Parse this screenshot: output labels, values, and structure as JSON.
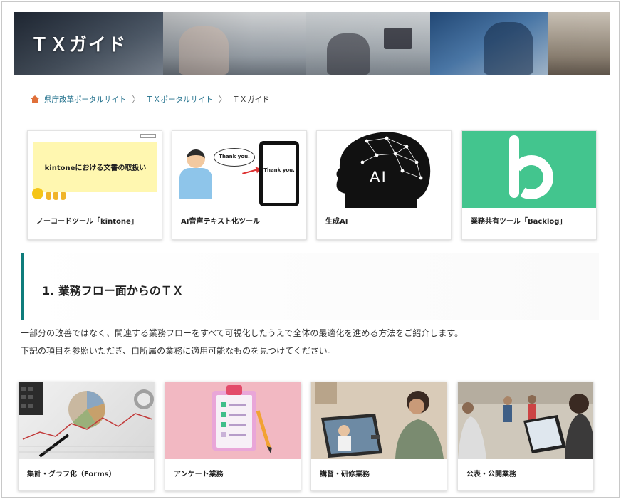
{
  "hero": {
    "title": "ＴＸガイド"
  },
  "breadcrumb": {
    "items": [
      {
        "label": "県庁改革ポータルサイト",
        "link": true
      },
      {
        "label": "ＴＸポータルサイト",
        "link": true
      },
      {
        "label": "ＴＸガイド",
        "link": false
      }
    ],
    "separator": "〉"
  },
  "top_cards": [
    {
      "label": "ノーコードツール「kintone」",
      "thumb_text": "kintoneにおける文書の取扱い"
    },
    {
      "label": "AI音声テキスト化ツール",
      "bubble_text": "Thank you.",
      "phone_text": "Thank you."
    },
    {
      "label": "生成AI",
      "thumb_text": "AI"
    },
    {
      "label": "業務共有ツール「Backlog」"
    }
  ],
  "section": {
    "title": "1. 業務フロー面からのＴＸ",
    "description_1": "一部分の改善ではなく、関連する業務フローをすべて可視化したうえで全体の最適化を進める方法をご紹介します。",
    "description_2": "下記の項目を参照いただき、自所属の業務に適用可能なものを見つけてください。",
    "accent_color": "#0e7c7b"
  },
  "bottom_cards": [
    {
      "label": "集計・グラフ化（Forms）"
    },
    {
      "label": "アンケート業務"
    },
    {
      "label": "講習・研修業務"
    },
    {
      "label": "公表・公開業務"
    }
  ]
}
